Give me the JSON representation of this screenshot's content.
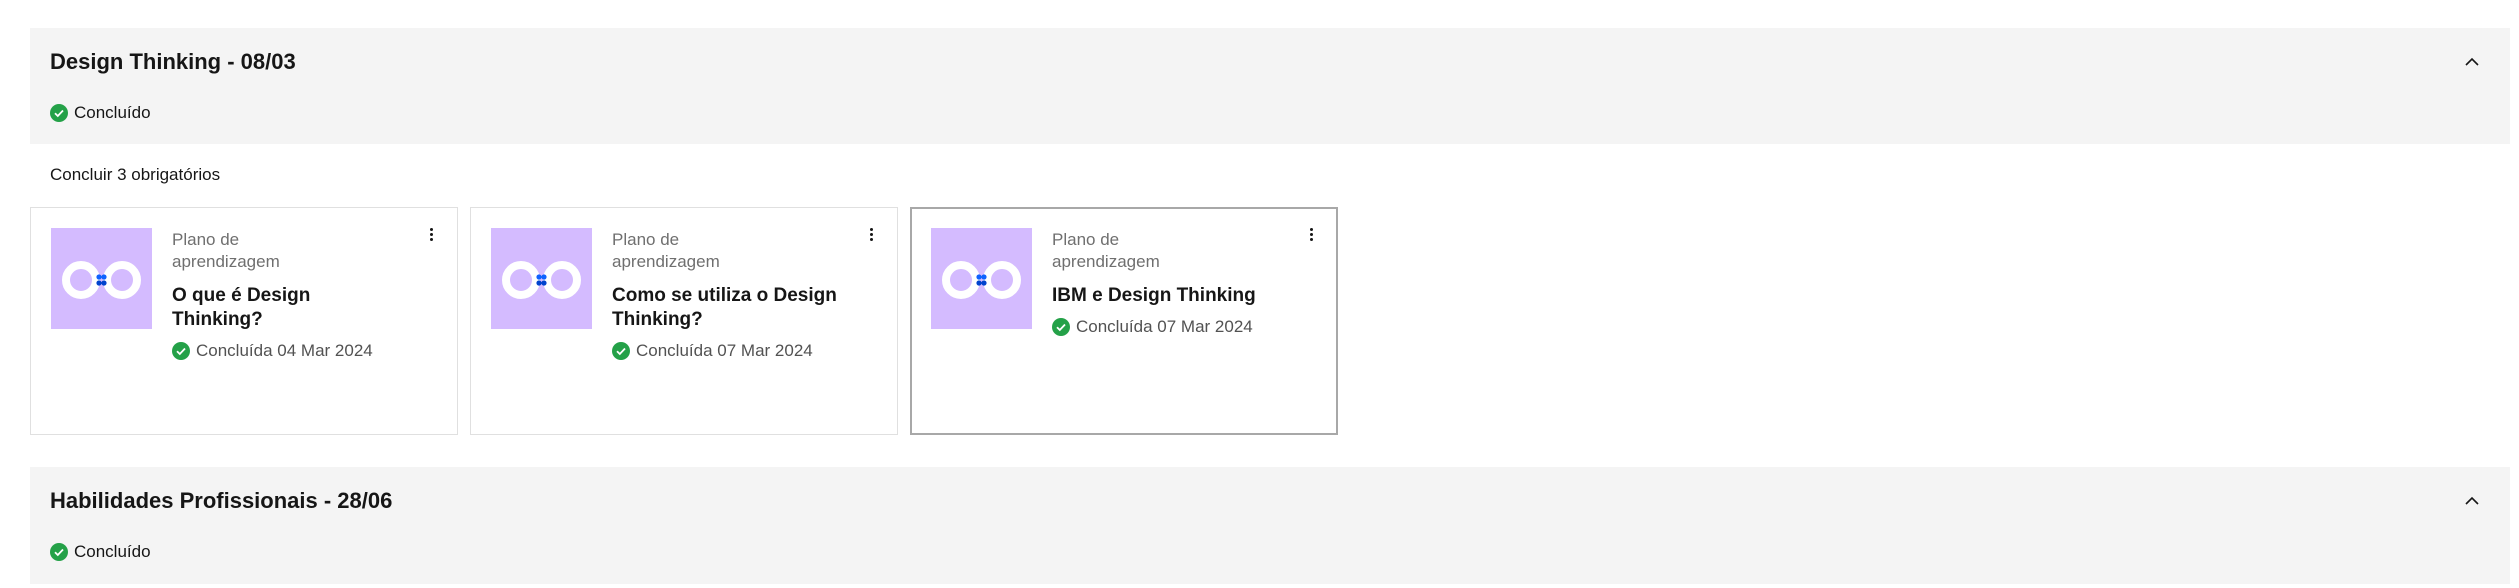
{
  "sections": [
    {
      "title": "Design Thinking - 08/03",
      "status": "Concluído",
      "required_text": "Concluir 3 obrigatórios",
      "cards": [
        {
          "type": "Plano de aprendizagem",
          "title": "O que é Design Thinking?",
          "status": "Concluída 04 Mar 2024"
        },
        {
          "type": "Plano de aprendizagem",
          "title": "Como se utiliza o Design Thinking?",
          "status": "Concluída 07 Mar 2024"
        },
        {
          "type": "Plano de aprendizagem",
          "title": "IBM e Design Thinking",
          "status": "Concluída 07 Mar 2024"
        }
      ]
    },
    {
      "title": "Habilidades Profissionais - 28/06",
      "status": "Concluído"
    }
  ],
  "colors": {
    "success": "#24a148",
    "thumb_bg": "#d4bbff",
    "section_bg": "#f4f4f4",
    "thumb_dots": "#0f62fe"
  },
  "icons": {
    "collapse": "chevron-up-icon",
    "status": "checkmark-filled-icon",
    "card_menu": "overflow-menu-vertical-icon",
    "thumbnail": "infinity-loop-icon"
  }
}
